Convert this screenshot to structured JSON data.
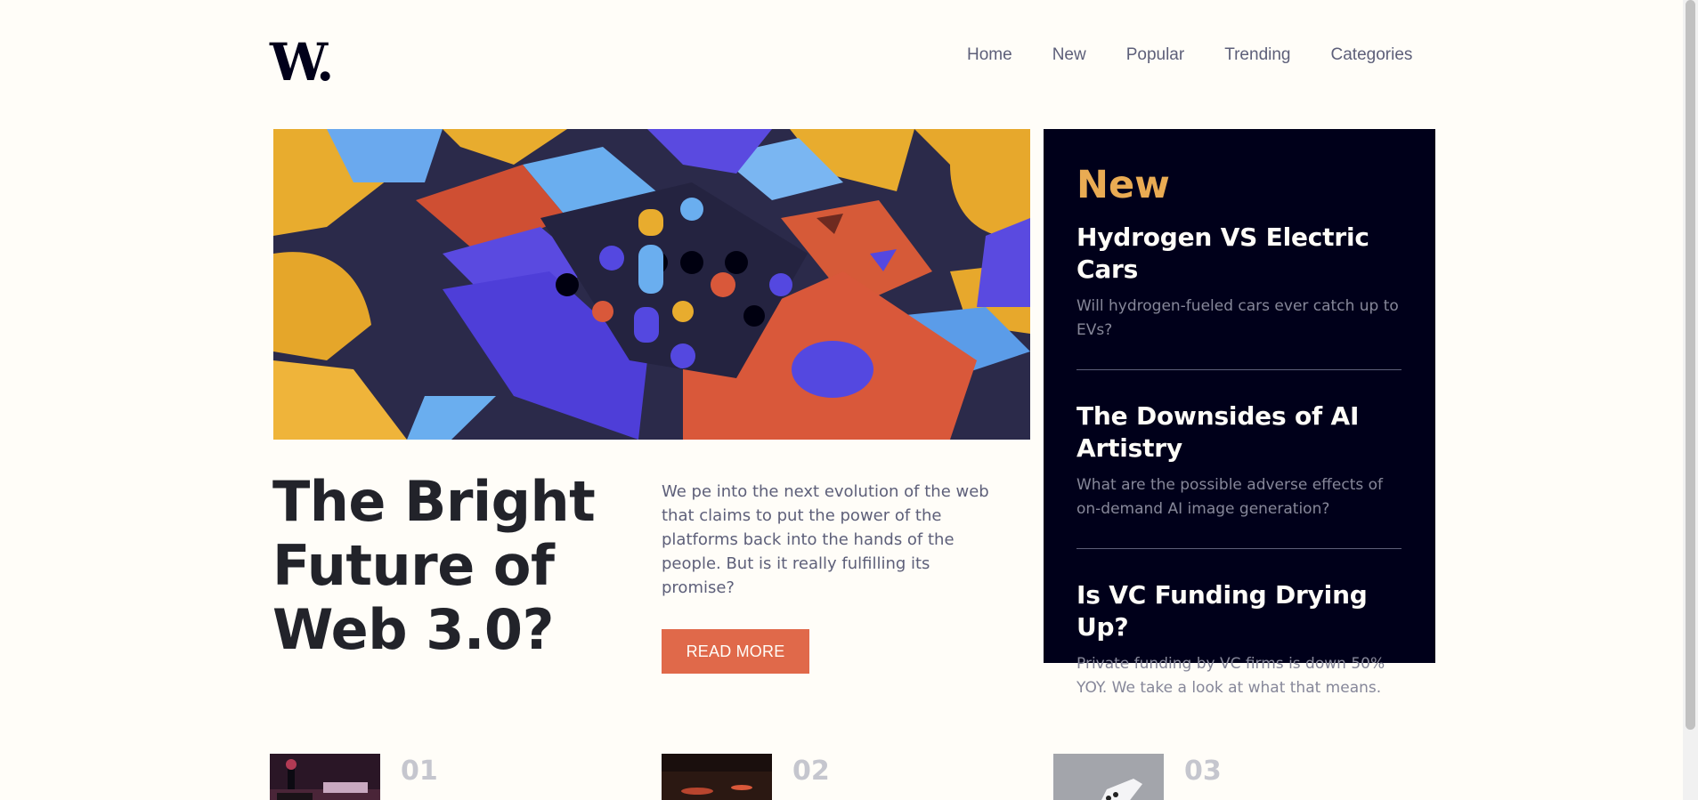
{
  "header": {
    "logo": "W.",
    "nav": [
      "Home",
      "New",
      "Popular",
      "Trending",
      "Categories"
    ]
  },
  "hero": {
    "title": "The Bright Future of Web 3.0?",
    "description": "We pe into the next evolution of the web that claims to put the power of the platforms back into the hands of the people. But is it really fulfilling its promise?",
    "button": "READ MORE"
  },
  "new_panel": {
    "heading": "New",
    "items": [
      {
        "title": "Hydrogen VS Electric Cars",
        "text": "Will hydrogen-fueled cars ever catch up to EVs?"
      },
      {
        "title": "The Downsides of AI Artistry",
        "text": "What are the possible adverse effects of on-demand AI image generation?"
      },
      {
        "title": "Is VC Funding Drying Up?",
        "text": "Private funding by VC firms is down 50% YOY. We take a look at what that means."
      }
    ]
  },
  "bottom_list": [
    {
      "number": "01"
    },
    {
      "number": "02"
    },
    {
      "number": "03"
    }
  ],
  "colors": {
    "background": "#fffdf8",
    "accent": "#e0694a",
    "panel_bg": "#00001a",
    "panel_heading": "#e9ab53",
    "muted": "#5d5f79"
  }
}
